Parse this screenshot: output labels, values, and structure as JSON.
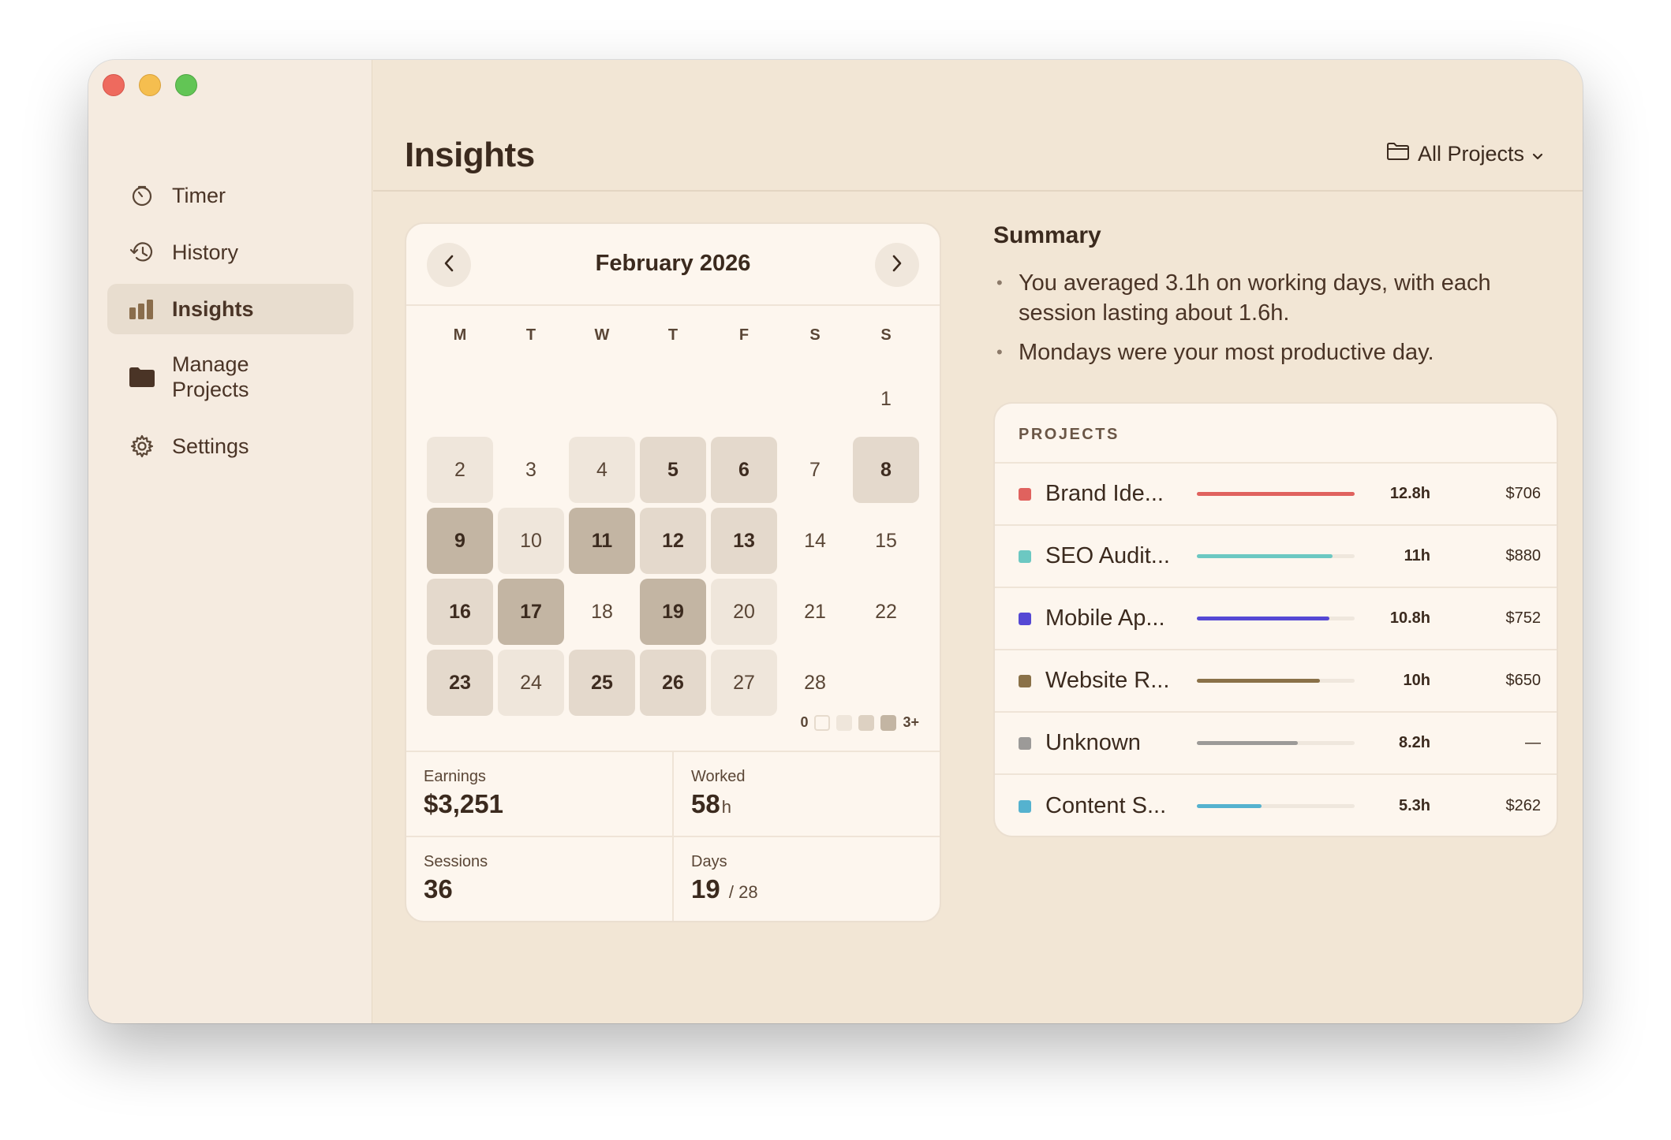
{
  "sidebar": {
    "items": [
      {
        "label": "Timer",
        "icon": "timer-icon",
        "active": false
      },
      {
        "label": "History",
        "icon": "history-icon",
        "active": false
      },
      {
        "label": "Insights",
        "icon": "bar-chart-icon",
        "active": true
      },
      {
        "label": "Manage\nProjects",
        "icon": "folder-icon",
        "active": false
      },
      {
        "label": "Settings",
        "icon": "gear-icon",
        "active": false
      }
    ]
  },
  "header": {
    "title": "Insights",
    "filter_label": "All Projects"
  },
  "calendar": {
    "month_label": "February 2026",
    "weekdays": [
      "M",
      "T",
      "W",
      "T",
      "F",
      "S",
      "S"
    ],
    "weeks": [
      [
        null,
        null,
        null,
        null,
        null,
        null,
        {
          "d": "1",
          "level": 0
        }
      ],
      [
        {
          "d": "2",
          "level": 1
        },
        {
          "d": "3",
          "level": 0
        },
        {
          "d": "4",
          "level": 1
        },
        {
          "d": "5",
          "level": 2
        },
        {
          "d": "6",
          "level": 2
        },
        {
          "d": "7",
          "level": 0
        },
        {
          "d": "8",
          "level": 2
        }
      ],
      [
        {
          "d": "9",
          "level": 3
        },
        {
          "d": "10",
          "level": 1
        },
        {
          "d": "11",
          "level": 3
        },
        {
          "d": "12",
          "level": 2
        },
        {
          "d": "13",
          "level": 2
        },
        {
          "d": "14",
          "level": 0
        },
        {
          "d": "15",
          "level": 0
        }
      ],
      [
        {
          "d": "16",
          "level": 2
        },
        {
          "d": "17",
          "level": 3
        },
        {
          "d": "18",
          "level": 0
        },
        {
          "d": "19",
          "level": 3
        },
        {
          "d": "20",
          "level": 1
        },
        {
          "d": "21",
          "level": 0
        },
        {
          "d": "22",
          "level": 0
        }
      ],
      [
        {
          "d": "23",
          "level": 2
        },
        {
          "d": "24",
          "level": 1
        },
        {
          "d": "25",
          "level": 2
        },
        {
          "d": "26",
          "level": 2
        },
        {
          "d": "27",
          "level": 1
        },
        {
          "d": "28",
          "level": 0
        },
        null
      ]
    ],
    "legend_min": "0",
    "legend_max": "3+",
    "level_colors": [
      "#fdf6ee",
      "#efe6db",
      "#e4d9cc",
      "#c3b5a3"
    ]
  },
  "stats": {
    "earnings_label": "Earnings",
    "earnings_value": "$3,251",
    "worked_label": "Worked",
    "worked_value": "58",
    "worked_unit": "h",
    "sessions_label": "Sessions",
    "sessions_value": "36",
    "days_label": "Days",
    "days_value": "19",
    "days_total": "/ 28"
  },
  "summary": {
    "title": "Summary",
    "bullets": [
      "You averaged 3.1h on working days, with each session lasting about 1.6h.",
      "Mondays were your most productive day."
    ]
  },
  "projects": {
    "header": "PROJECTS",
    "rows": [
      {
        "name": "Brand Ide...",
        "hours": "12.8h",
        "amount": "$706",
        "color": "#e0625e",
        "share": 1.0
      },
      {
        "name": "SEO Audit...",
        "hours": "11h",
        "amount": "$880",
        "color": "#6cc8c2",
        "share": 0.86
      },
      {
        "name": "Mobile Ap...",
        "hours": "10.8h",
        "amount": "$752",
        "color": "#5548d4",
        "share": 0.84
      },
      {
        "name": "Website R...",
        "hours": "10h",
        "amount": "$650",
        "color": "#8a7148",
        "share": 0.78
      },
      {
        "name": "Unknown",
        "hours": "8.2h",
        "amount": "—",
        "color": "#9c9a98",
        "share": 0.64
      },
      {
        "name": "Content S...",
        "hours": "5.3h",
        "amount": "$262",
        "color": "#55b2cf",
        "share": 0.41
      }
    ]
  }
}
